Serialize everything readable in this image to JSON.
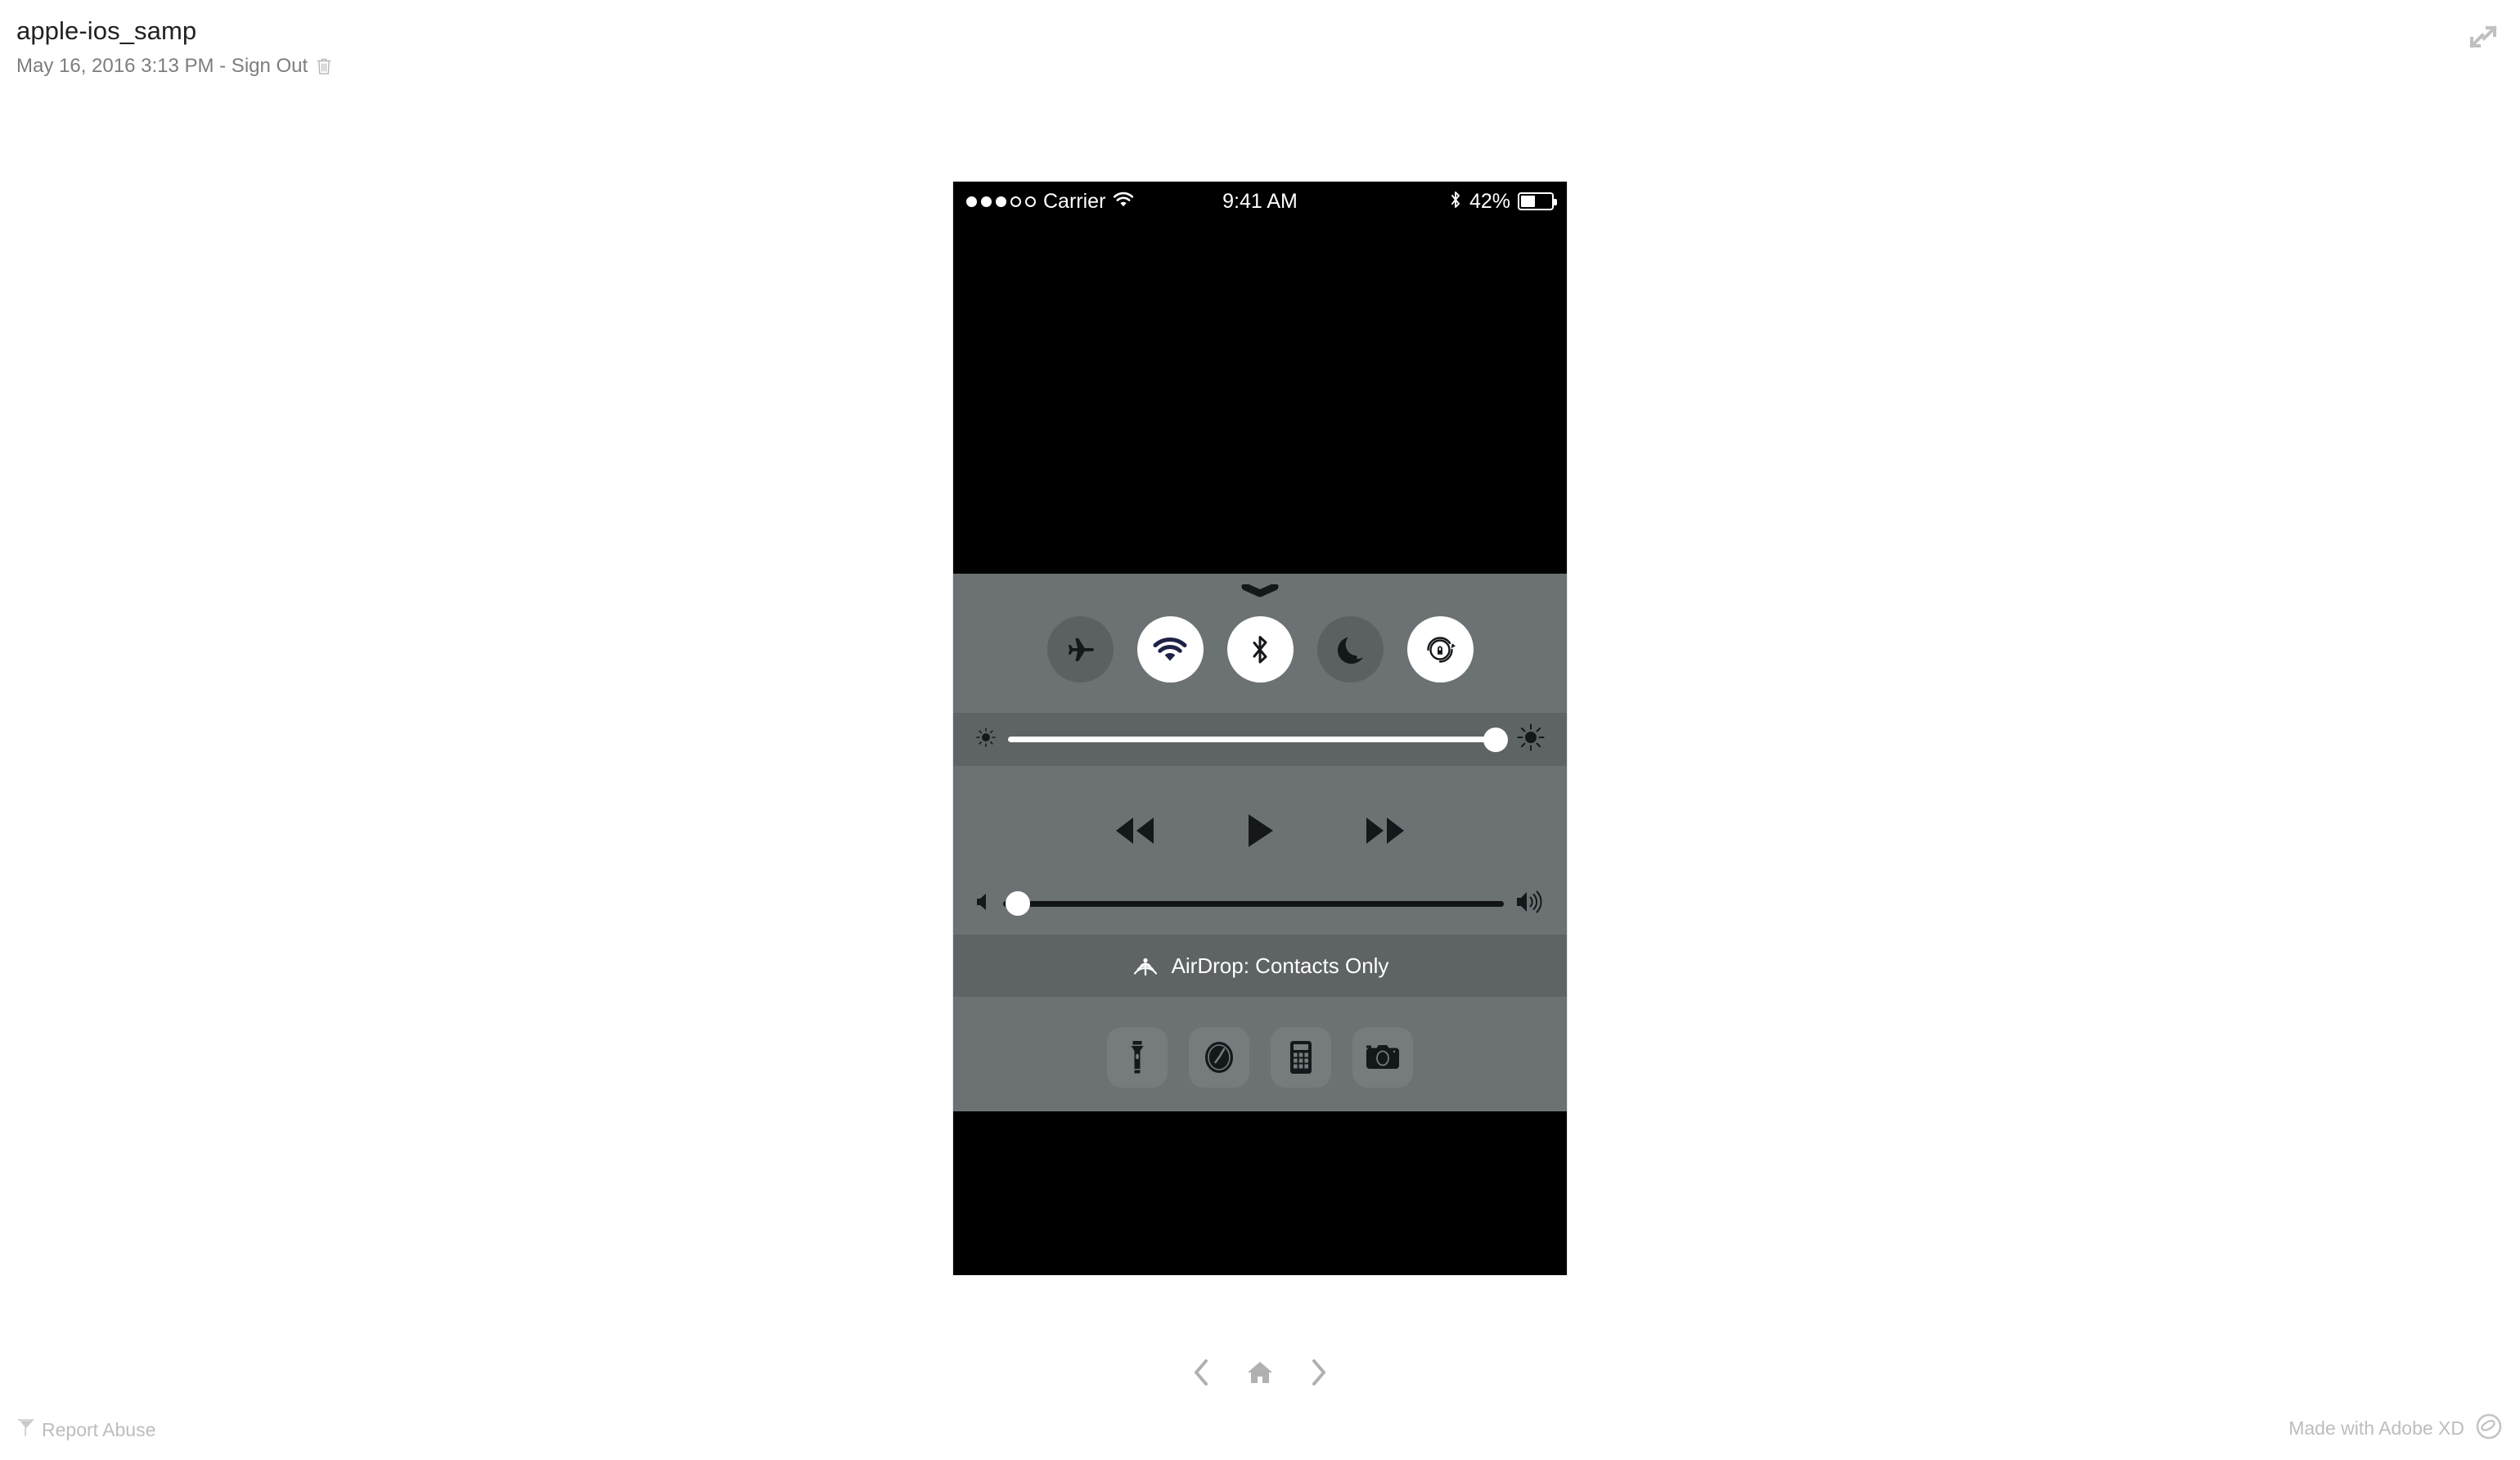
{
  "header": {
    "project_title": "apple-ios_samp",
    "meta_text": "May 16, 2016 3:13 PM - Sign Out",
    "delete_icon": "trash-icon",
    "expand_icon": "expand-arrows-icon"
  },
  "phone": {
    "status_bar": {
      "signal_dots_filled": 3,
      "signal_dots_total": 5,
      "carrier": "Carrier",
      "wifi_icon": "wifi-icon",
      "time": "9:41 AM",
      "bluetooth_icon": "bluetooth-icon",
      "battery_percent": "42%",
      "battery_level": 42
    },
    "control_center": {
      "grabber_icon": "grabber-chevron-icon",
      "toggles": [
        {
          "name": "airplane-mode",
          "icon": "airplane-icon",
          "state": "off"
        },
        {
          "name": "wifi",
          "icon": "wifi-icon",
          "state": "on"
        },
        {
          "name": "bluetooth",
          "icon": "bluetooth-icon",
          "state": "on"
        },
        {
          "name": "do-not-disturb",
          "icon": "moon-icon",
          "state": "off"
        },
        {
          "name": "rotation-lock",
          "icon": "rotation-lock-icon",
          "state": "on"
        }
      ],
      "brightness": {
        "min_icon": "sun-small-icon",
        "max_icon": "sun-large-icon",
        "value": 98
      },
      "media": {
        "rewind_icon": "rewind-icon",
        "play_icon": "play-icon",
        "forward_icon": "fast-forward-icon"
      },
      "volume": {
        "min_icon": "volume-mute-icon",
        "max_icon": "volume-high-icon",
        "value": 3
      },
      "airdrop": {
        "icon": "airdrop-icon",
        "label": "AirDrop: Contacts Only"
      },
      "shortcuts": [
        {
          "name": "flashlight",
          "icon": "flashlight-icon"
        },
        {
          "name": "timer",
          "icon": "timer-icon"
        },
        {
          "name": "calculator",
          "icon": "calculator-icon"
        },
        {
          "name": "camera",
          "icon": "camera-icon"
        }
      ]
    }
  },
  "footer": {
    "prev_icon": "chevron-left-icon",
    "home_icon": "home-icon",
    "next_icon": "chevron-right-icon",
    "report_abuse_label": "Report Abuse",
    "report_abuse_icon": "flag-icon",
    "made_with_label": "Made with Adobe XD",
    "made_with_icon": "adobe-creative-cloud-icon"
  },
  "colors": {
    "page_background": "#ffffff",
    "screen_background": "#000000",
    "panel_light": "#6c7174",
    "panel_dark": "#5e6365",
    "toggle_off": "#5b6063",
    "toggle_on": "#ffffff",
    "shortcut_tile": "#767b7e",
    "icon_dark": "#14171a",
    "wifi_icon_color": "#1f2247",
    "footer_gray": "#bdbdbd"
  }
}
